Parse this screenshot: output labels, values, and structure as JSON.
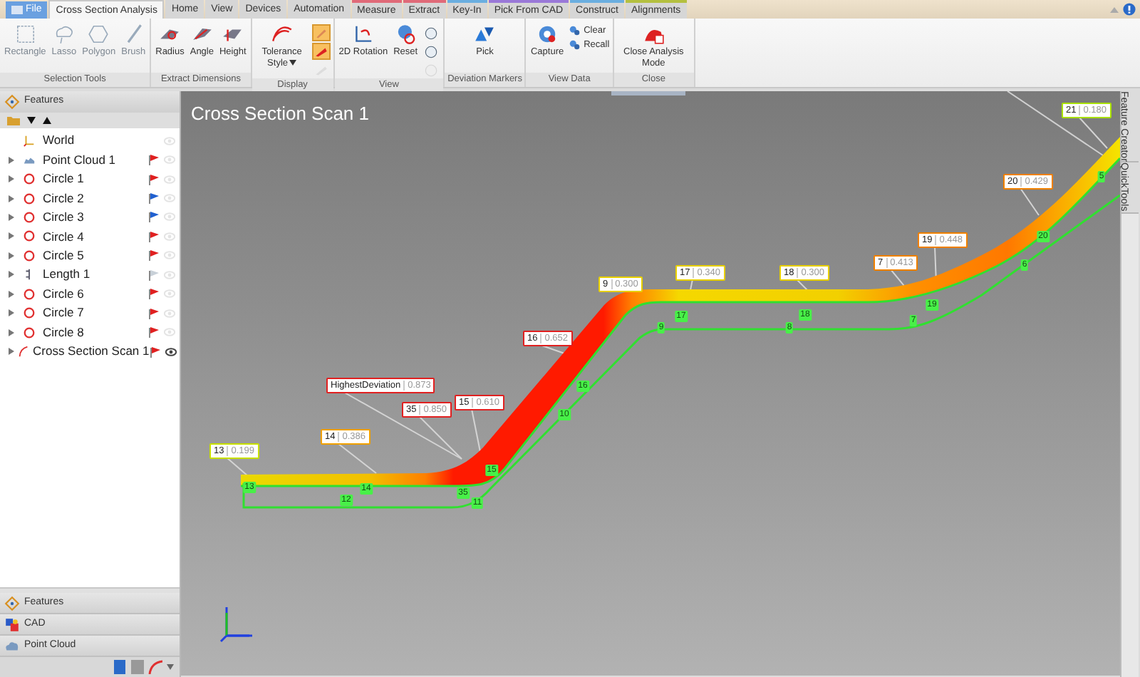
{
  "ribbon": {
    "tabs": [
      {
        "label": "File",
        "kind": "file",
        "selected": false
      },
      {
        "label": "Cross Section Analysis",
        "kind": "tab",
        "selected": true
      },
      {
        "label": "Home",
        "kind": "tab",
        "selected": false
      },
      {
        "label": "View",
        "kind": "tab",
        "selected": false
      },
      {
        "label": "Devices",
        "kind": "tab",
        "selected": false
      },
      {
        "label": "Automation",
        "kind": "tab",
        "selected": false
      },
      {
        "label": "Measure",
        "kind": "tab",
        "selected": false,
        "color": "#e06a78"
      },
      {
        "label": "Extract",
        "kind": "tab",
        "selected": false,
        "color": "#e06a78"
      },
      {
        "label": "Key-In",
        "kind": "tab",
        "selected": false,
        "color": "#6aaee0"
      },
      {
        "label": "Pick From CAD",
        "kind": "tab",
        "selected": false,
        "color": "#9a78d8"
      },
      {
        "label": "Construct",
        "kind": "tab",
        "selected": false,
        "color": "#6aaee0"
      },
      {
        "label": "Alignments",
        "kind": "tab",
        "selected": false,
        "color": "#b4c040"
      }
    ],
    "groups": [
      {
        "label": "Selection Tools",
        "buttons": [
          {
            "label": "Rectangle",
            "kind": "large",
            "disabled": true
          },
          {
            "label": "Lasso",
            "kind": "large",
            "disabled": true
          },
          {
            "label": "Polygon",
            "kind": "large",
            "disabled": true
          },
          {
            "label": "Brush",
            "kind": "large",
            "disabled": true
          }
        ]
      },
      {
        "label": "Extract Dimensions",
        "buttons": [
          {
            "label": "Radius",
            "kind": "large",
            "disabled": false
          },
          {
            "label": "Angle",
            "kind": "large",
            "disabled": false
          },
          {
            "label": "Height",
            "kind": "large",
            "disabled": false
          }
        ]
      },
      {
        "label": "Display",
        "buttons": [
          {
            "label": "Tolerance Style",
            "kind": "dropdown",
            "disabled": false,
            "selected": false
          },
          {
            "kind": "icon",
            "disabled": false,
            "selected": true
          },
          {
            "kind": "icon",
            "disabled": false,
            "selected": true
          },
          {
            "kind": "icon",
            "disabled": true,
            "selected": false
          }
        ]
      },
      {
        "label": "View",
        "buttons": [
          {
            "label": "2D Rotation",
            "kind": "large",
            "disabled": false
          },
          {
            "label": "Reset",
            "kind": "large",
            "disabled": false
          },
          {
            "kind": "icon",
            "disabled": false
          },
          {
            "kind": "icon",
            "disabled": false
          },
          {
            "kind": "icon",
            "disabled": true
          }
        ]
      },
      {
        "label": "Deviation Markers",
        "buttons": [
          {
            "label": "Pick",
            "kind": "large",
            "disabled": false
          }
        ]
      },
      {
        "label": "View Data",
        "buttons": [
          {
            "label": "Capture",
            "kind": "large",
            "disabled": false
          },
          {
            "label": "Clear",
            "kind": "small",
            "disabled": false
          },
          {
            "label": "Recall",
            "kind": "small",
            "disabled": false
          }
        ]
      },
      {
        "label": "Close",
        "buttons": [
          {
            "label": "Close Analysis Mode",
            "kind": "large",
            "disabled": false
          }
        ]
      }
    ]
  },
  "features_panel": {
    "title": "Features",
    "items": [
      {
        "label": "World",
        "kind": "axes",
        "expandable": false,
        "visible": false
      },
      {
        "label": "Point Cloud 1",
        "kind": "cloud",
        "expandable": true,
        "visible": false,
        "color": "#e02020"
      },
      {
        "label": "Circle 1",
        "kind": "circle",
        "expandable": true,
        "visible": false,
        "color": "#e02020"
      },
      {
        "label": "Circle 2",
        "kind": "circle",
        "expandable": true,
        "visible": false,
        "color": "#2060d0"
      },
      {
        "label": "Circle 3",
        "kind": "circle",
        "expandable": true,
        "visible": false,
        "color": "#2060d0"
      },
      {
        "label": "Circle 4",
        "kind": "circle",
        "expandable": true,
        "visible": false,
        "color": "#e02020"
      },
      {
        "label": "Circle 5",
        "kind": "circle",
        "expandable": true,
        "visible": false,
        "color": "#e02020"
      },
      {
        "label": "Length 1",
        "kind": "length",
        "expandable": true,
        "visible": false,
        "color": "#c8d0d8"
      },
      {
        "label": "Circle 6",
        "kind": "circle",
        "expandable": true,
        "visible": false,
        "color": "#e02020"
      },
      {
        "label": "Circle 7",
        "kind": "circle",
        "expandable": true,
        "visible": false,
        "color": "#e02020"
      },
      {
        "label": "Circle 8",
        "kind": "circle",
        "expandable": true,
        "visible": false,
        "color": "#e02020"
      },
      {
        "label": "Cross Section Scan 1",
        "kind": "scan",
        "expandable": true,
        "visible": true,
        "color": "#e02020"
      }
    ]
  },
  "nav_panes": [
    {
      "label": "Features",
      "kind": "features"
    },
    {
      "label": "CAD",
      "kind": "cad"
    },
    {
      "label": "Point Cloud",
      "kind": "cloud"
    }
  ],
  "viewport": {
    "title": "Cross Section Scan 1",
    "labels": [
      {
        "id": "13",
        "value": "0.199",
        "color": "#c8e000"
      },
      {
        "id": "14",
        "value": "0.386",
        "color": "#f0a000"
      },
      {
        "id": "HighestDeviation",
        "value": "0.873",
        "color": "#e02020"
      },
      {
        "id": "35",
        "value": "0.850",
        "color": "#e02020"
      },
      {
        "id": "15",
        "value": "0.610",
        "color": "#e02020"
      },
      {
        "id": "16",
        "value": "0.652",
        "color": "#e02020"
      },
      {
        "id": "9",
        "value": "0.300",
        "color": "#e8d000"
      },
      {
        "id": "17",
        "value": "0.340",
        "color": "#e8d000"
      },
      {
        "id": "18",
        "value": "0.300",
        "color": "#e8d000"
      },
      {
        "id": "7",
        "value": "0.413",
        "color": "#f08000"
      },
      {
        "id": "19",
        "value": "0.448",
        "color": "#f08000"
      },
      {
        "id": "20",
        "value": "0.429",
        "color": "#f08000"
      },
      {
        "id": "21",
        "value": "0.180",
        "color": "#a8e000"
      }
    ],
    "markers": [
      "13",
      "12",
      "14",
      "35",
      "11",
      "15",
      "10",
      "16",
      "9",
      "17",
      "8",
      "18",
      "7",
      "19",
      "6",
      "20",
      "5"
    ]
  },
  "side_tabs": [
    "Feature Creator",
    "QuickTools"
  ]
}
